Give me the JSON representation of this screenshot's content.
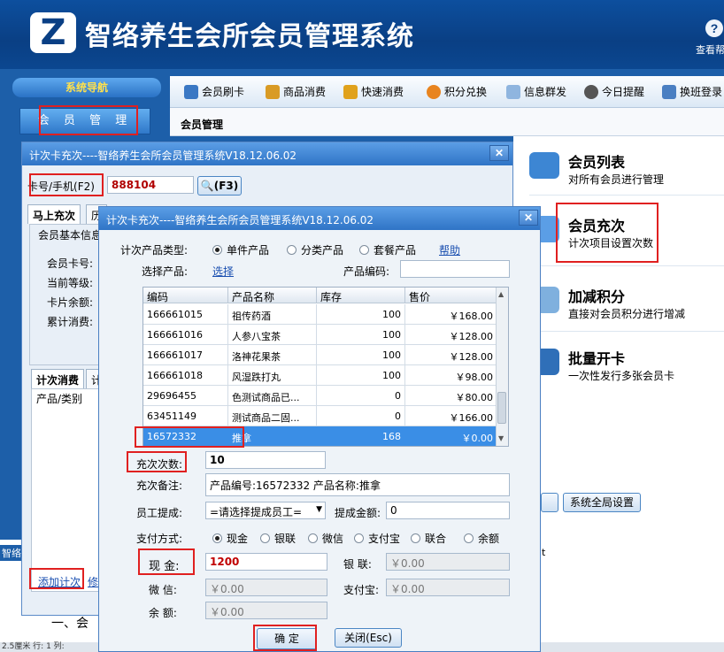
{
  "app": {
    "title": "智络养生会所会员管理系统",
    "logo_letter": "Z",
    "help_label": "查看帮"
  },
  "nav": {
    "header": "系统导航",
    "member_mgmt": "会 员 管 理"
  },
  "toolbar": [
    {
      "label": "会员刷卡",
      "icon": "card-icon"
    },
    {
      "label": "商品消费",
      "icon": "money-bag-icon"
    },
    {
      "label": "快速消费",
      "icon": "lightning-icon"
    },
    {
      "label": "积分兑换",
      "icon": "exchange-icon"
    },
    {
      "label": "信息群发",
      "icon": "mail-icon"
    },
    {
      "label": "今日提醒",
      "icon": "clock-icon"
    },
    {
      "label": "换班登录",
      "icon": "shift-icon"
    }
  ],
  "breadcrumb": "会员管理",
  "right_panel": [
    {
      "title": "会员列表",
      "desc": "对所有会员进行管理",
      "icon": "member-list-icon"
    },
    {
      "title": "会员充次",
      "desc": "计次项目设置次数",
      "icon": "member-recharge-icon"
    },
    {
      "title": "加减积分",
      "desc": "直接对会员积分进行增减",
      "icon": "points-icon"
    },
    {
      "title": "批量开卡",
      "desc": "一次性发行多张会员卡",
      "icon": "batch-card-icon"
    }
  ],
  "global_settings": "系统全局设置",
  "bottom": {
    "left_stub": "智络",
    "t_stub": "t",
    "doc_stub": "一、会",
    "status": "2.5厘米  行: 1  列:"
  },
  "dlg1": {
    "title": "计次卡充次----智络养生会所会员管理系统V18.12.06.02",
    "card_label": "卡号/手机(F2)",
    "card_value": "888104",
    "search_btn": "(F3)",
    "tabs": [
      "马上充次",
      "历"
    ],
    "section": "会员基本信息",
    "fields": [
      "会员卡号:",
      "当前等级:",
      "卡片余额:",
      "累计消费:"
    ],
    "sub_tabs": [
      "计次消费",
      "计"
    ],
    "list_header": "产品/类别",
    "add_link": "添加计次",
    "edit_link": "修"
  },
  "dlg2": {
    "title": "计次卡充次----智络养生会所会员管理系统V18.12.06.02",
    "type_label": "计次产品类型:",
    "types": [
      "单件产品",
      "分类产品",
      "套餐产品"
    ],
    "help": "帮助",
    "select_label": "选择产品:",
    "select_link": "选择",
    "code_label": "产品编码:",
    "columns": [
      "编码",
      "产品名称",
      "库存",
      "售价"
    ],
    "rows": [
      [
        "166661015",
        "祖传药酒",
        "100",
        "￥168.00"
      ],
      [
        "166661016",
        "人参八宝茶",
        "100",
        "￥128.00"
      ],
      [
        "166661017",
        "洛神花果茶",
        "100",
        "￥128.00"
      ],
      [
        "166661018",
        "风湿跌打丸",
        "100",
        "￥98.00"
      ],
      [
        "29696455",
        "色测试商品已...",
        "0",
        "￥80.00"
      ],
      [
        "63451149",
        "测试商品二固...",
        "0",
        "￥166.00"
      ],
      [
        "16572332",
        "推拿",
        "168",
        "￥0.00"
      ]
    ],
    "count_label": "充次次数:",
    "count_value": "10",
    "note_label": "充次备注:",
    "note_value": "产品编号:16572332 产品名称:推拿",
    "staff_label": "员工提成:",
    "staff_value": "=请选择提成员工=",
    "commission_label": "提成金额:",
    "commission_value": "0",
    "pay_label": "支付方式:",
    "pay_methods": [
      "现金",
      "银联",
      "微信",
      "支付宝",
      "联合",
      "余额"
    ],
    "cash_label": "现  金:",
    "cash_value": "1200",
    "unionpay_label": "银  联:",
    "unionpay_value": "￥0.00",
    "wechat_label": "微  信:",
    "wechat_value": "￥0.00",
    "alipay_label": "支付宝:",
    "alipay_value": "￥0.00",
    "balance_label": "余  额:",
    "balance_value": "￥0.00",
    "ok_btn": "确  定",
    "close_btn": "关闭(Esc)"
  },
  "colors": {
    "accent": "#2f74c6",
    "highlight": "#e02020",
    "selected_row": "#3a8ee6"
  }
}
